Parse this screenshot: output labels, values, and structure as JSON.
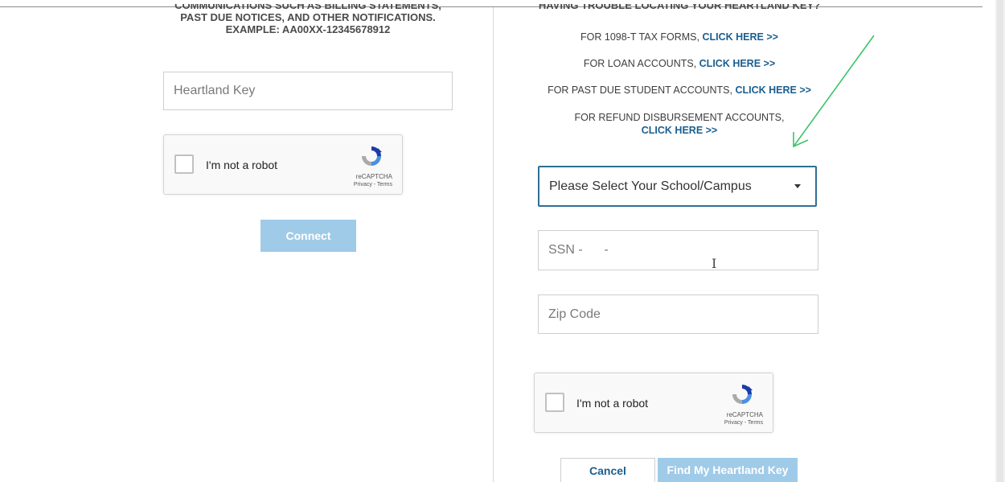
{
  "left_panel": {
    "intro_lines": [
      "COMMUNICATIONS SUCH AS BILLING STATEMENTS,",
      "PAST DUE NOTICES, AND OTHER NOTIFICATIONS.",
      "EXAMPLE: AA00XX-12345678912"
    ],
    "heartland_key_placeholder": "Heartland Key",
    "captcha": {
      "label": "I'm not a robot",
      "brand": "reCAPTCHA",
      "terms": "Privacy - Terms"
    },
    "connect_button": "Connect"
  },
  "right_panel": {
    "trouble_heading": "HAVING TROUBLE LOCATING YOUR HEARTLAND KEY?",
    "links": [
      {
        "text": "FOR 1098-T TAX FORMS,",
        "link": "CLICK HERE >>"
      },
      {
        "text": "FOR LOAN ACCOUNTS,",
        "link": "CLICK HERE >>"
      },
      {
        "text": "FOR PAST DUE STUDENT ACCOUNTS,",
        "link": "CLICK HERE >>"
      },
      {
        "text": "FOR REFUND DISBURSEMENT ACCOUNTS,",
        "link": "CLICK HERE >>"
      }
    ],
    "school_select": "Please Select Your School/Campus",
    "ssn_placeholder": "SSN -      -",
    "zip_placeholder": "Zip Code",
    "captcha": {
      "label": "I'm not a robot",
      "brand": "reCAPTCHA",
      "terms": "Privacy - Terms"
    },
    "cancel_button": "Cancel",
    "find_button": "Find My Heartland Key"
  },
  "colors": {
    "link": "#1b5e8e",
    "disabled_button": "#9fcbe8",
    "select_border": "#2f6f95",
    "annotation_arrow": "#3cc36b"
  },
  "icons": [
    "recaptcha-logo-icon",
    "chevron-down-icon",
    "text-cursor-icon",
    "annotation-arrow-icon"
  ]
}
